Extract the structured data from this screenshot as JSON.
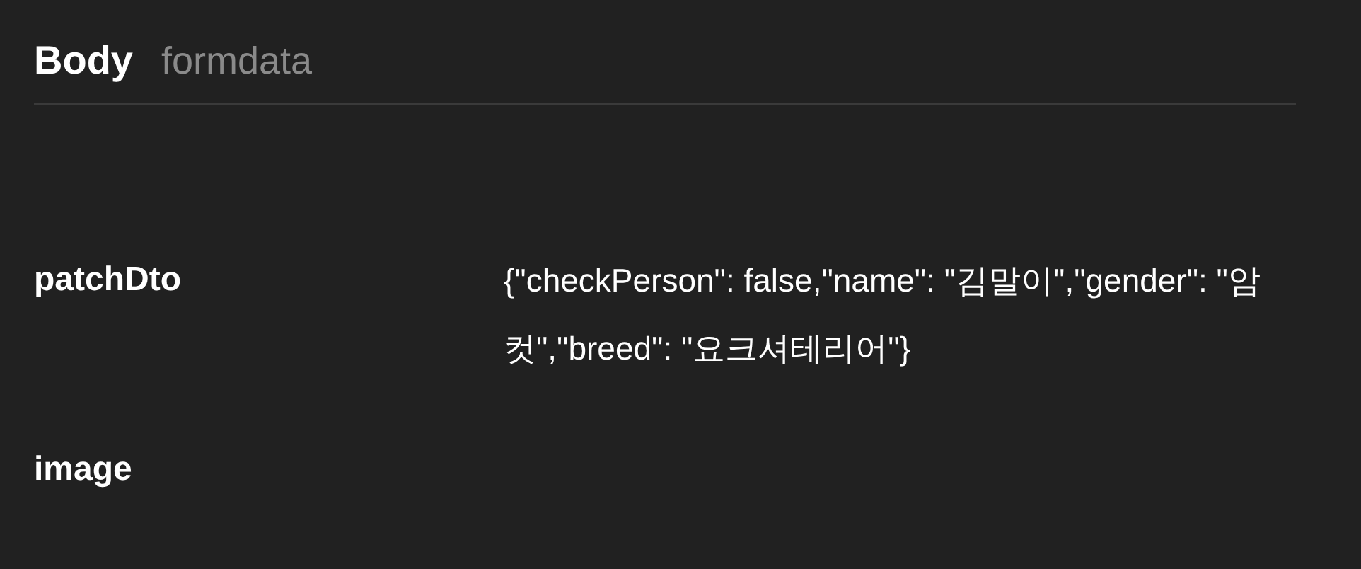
{
  "header": {
    "title": "Body",
    "subtitle": "formdata"
  },
  "fields": [
    {
      "name": "patchDto",
      "value": "{\"checkPerson\": false,\"name\": \"김말이\",\"gender\": \"암컷\",\"breed\": \"요크셔테리어\"}"
    },
    {
      "name": "image"
    }
  ]
}
